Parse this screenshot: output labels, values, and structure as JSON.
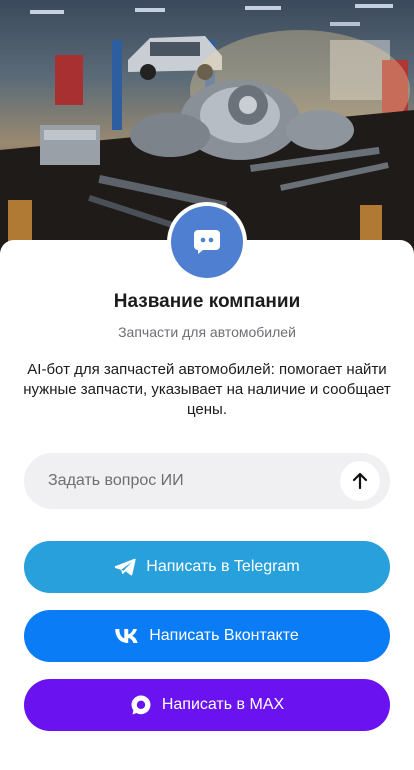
{
  "company": {
    "name": "Название компании",
    "subtitle": "Запчасти для автомобилей",
    "description": "AI-бот для запчастей автомобилей: помогает найти нужные запчасти, указывает на наличие и сообщает цены."
  },
  "ask": {
    "placeholder": "Задать вопрос ИИ",
    "send_icon": "arrow-up-icon"
  },
  "buttons": [
    {
      "label": "Написать в Telegram",
      "icon": "telegram-icon",
      "color": "#27a0db"
    },
    {
      "label": "Написать Вконтакте",
      "icon": "vk-icon",
      "color": "#0a7cf5"
    },
    {
      "label": "Написать в MAX",
      "icon": "max-icon",
      "color": "#6a12f0"
    }
  ],
  "colors": {
    "avatar": "#4f7fd0",
    "input_bg": "#f0f0f2"
  }
}
